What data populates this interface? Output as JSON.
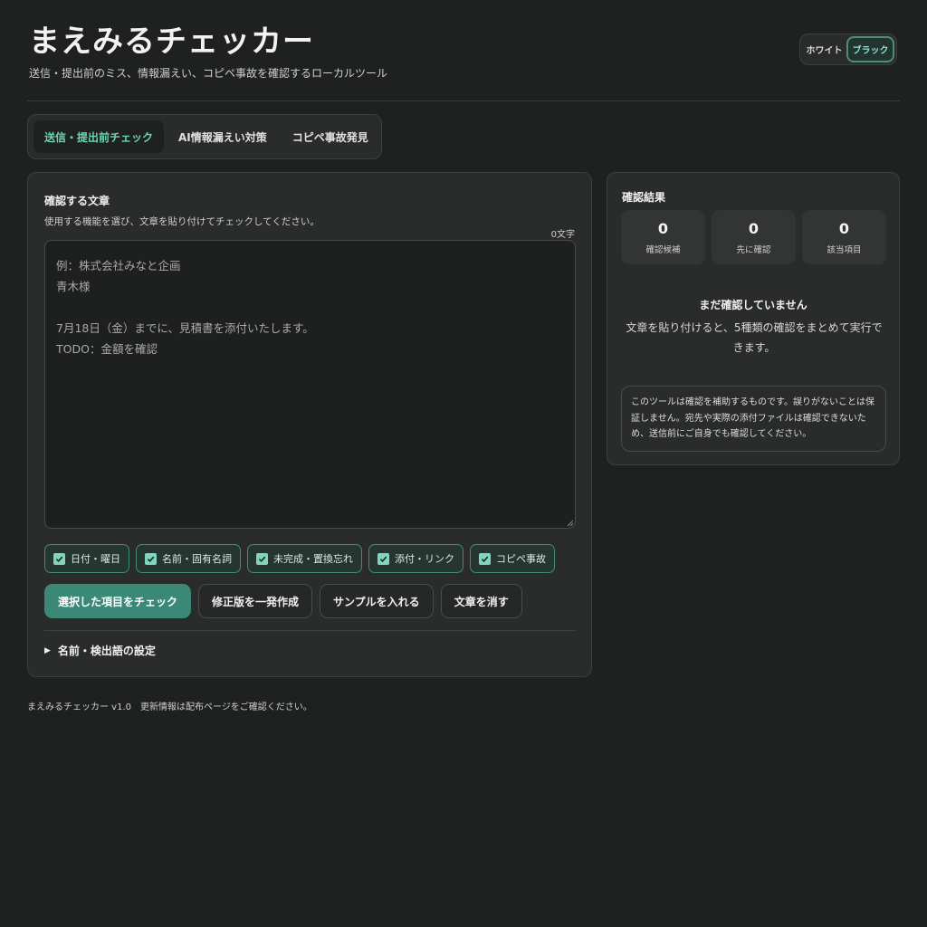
{
  "header": {
    "title": "まえみるチェッカー",
    "subtitle": "送信・提出前のミス、情報漏えい、コピペ事故を確認するローカルツール"
  },
  "theme": {
    "options": [
      "ホワイト",
      "ブラック"
    ],
    "selected": "ブラック"
  },
  "tabs": [
    {
      "label": "送信・提出前チェック",
      "active": true
    },
    {
      "label": "AI情報漏えい対策",
      "active": false
    },
    {
      "label": "コピペ事故発見",
      "active": false
    }
  ],
  "editor": {
    "heading": "確認する文章",
    "description": "使用する機能を選び、文章を貼り付けてチェックしてください。",
    "char_count": "0文字",
    "value": "",
    "placeholder": "例：株式会社みなと企画\n青木様\n\n7月18日（金）までに、見積書を添付いたします。\nTODO：金額を確認"
  },
  "checks": [
    {
      "label": "日付・曜日",
      "checked": true
    },
    {
      "label": "名前・固有名詞",
      "checked": true
    },
    {
      "label": "未完成・置換忘れ",
      "checked": true
    },
    {
      "label": "添付・リンク",
      "checked": true
    },
    {
      "label": "コピペ事故",
      "checked": true
    }
  ],
  "actions": {
    "check": "選択した項目をチェック",
    "revise": "修正版を一発作成",
    "sample": "サンプルを入れる",
    "clear": "文章を消す"
  },
  "settings_label": "名前・検出語の設定",
  "results": {
    "heading": "確認結果",
    "stats": [
      {
        "value": "0",
        "label": "確認候補"
      },
      {
        "value": "0",
        "label": "先に確認"
      },
      {
        "value": "0",
        "label": "該当項目"
      }
    ],
    "empty_title": "まだ確認していません",
    "empty_desc": "文章を貼り付けると、5種類の確認をまとめて実行できます。",
    "notice": "このツールは確認を補助するものです。誤りがないことは保証しません。宛先や実際の添付ファイルは確認できないため、送信前にご自身でも確認してください。"
  },
  "footer": "まえみるチェッカー v1.0　更新情報は配布ページをご確認ください。",
  "colors": {
    "background": "#1f2020",
    "panel": "#2a2c2b",
    "accent": "#3b8877",
    "accent_text": "#6fd2b2"
  }
}
